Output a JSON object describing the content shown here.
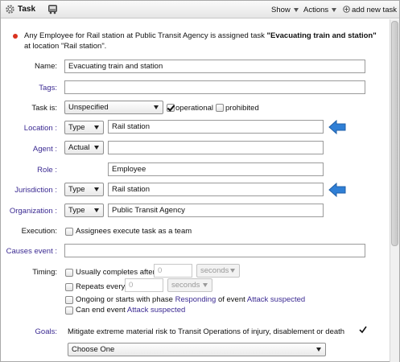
{
  "header": {
    "title": "Task",
    "show_label": "Show",
    "actions_label": "Actions",
    "add_new_task_label": "add new task"
  },
  "summary": {
    "prefix": "Any Employee for Rail station at Public Transit Agency is assigned task ",
    "task_name": "\"Evacuating train and station\"",
    "suffix": " at location \"Rail station\"."
  },
  "form": {
    "name": {
      "label": "Name:",
      "value": "Evacuating train and station"
    },
    "tags": {
      "label": "Tags:",
      "value": ""
    },
    "task_is": {
      "label": "Task is:",
      "selected": "Unspecified",
      "operational_label": "operational",
      "operational_checked": true,
      "prohibited_label": "prohibited",
      "prohibited_checked": false
    },
    "location": {
      "label": "Location :",
      "type": "Type",
      "value": "Rail station"
    },
    "agent": {
      "label": "Agent :",
      "type": "Actual",
      "value": ""
    },
    "role": {
      "label": "Role :",
      "value": "Employee"
    },
    "jurisdiction": {
      "label": "Jurisdiction :",
      "type": "Type",
      "value": "Rail station"
    },
    "organization": {
      "label": "Organization :",
      "type": "Type",
      "value": "Public Transit Agency"
    },
    "execution": {
      "label": "Execution:",
      "option_label": "Assignees execute task as a team",
      "checked": false
    },
    "causes_event": {
      "label": "Causes event :",
      "value": ""
    },
    "timing": {
      "label": "Timing:",
      "completes_label": "Usually completes after",
      "completes_value": "0",
      "completes_unit": "seconds",
      "repeats_label": "Repeats every",
      "repeats_value": "0",
      "repeats_unit": "seconds",
      "ongoing_prefix": "Ongoing or starts with phase",
      "ongoing_phase": "Responding",
      "ongoing_mid": "of event",
      "ongoing_event": "Attack suspected",
      "can_end_prefix": "Can end event",
      "can_end_event": "Attack suspected"
    },
    "goals": {
      "label": "Goals:",
      "goal_text": "Mitigate extreme material risk to Transit Operations of injury, disablement or death",
      "goal_checked": true,
      "choose_placeholder": "Choose One"
    }
  },
  "colors": {
    "link_purple": "#3b2a92",
    "arrow_blue": "#2f7fd6",
    "bullet_red": "#d9321f"
  }
}
